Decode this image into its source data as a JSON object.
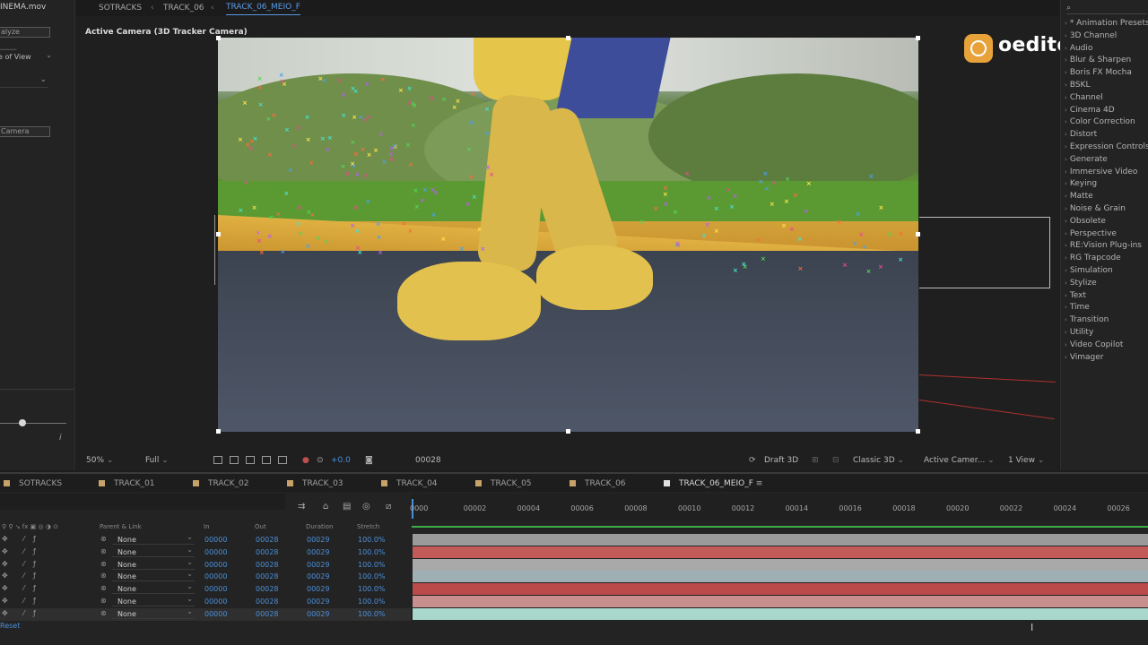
{
  "left_panel": {
    "title": "INEMA.mov",
    "analyze_button": "alyze",
    "shot_type_label": "e of View",
    "camera_button": "Camera",
    "info_icon": "i"
  },
  "breadcrumbs": [
    "SOTRACKS",
    "TRACK_06",
    "TRACK_06_MEIO_F"
  ],
  "viewer": {
    "camera_label": "Active Camera (3D Tracker Camera)"
  },
  "viewer_toolbar": {
    "zoom": "50%",
    "resolution": "Full",
    "exposure": "+0.0",
    "frame": "00028",
    "draft": "Draft 3D",
    "renderer": "Classic 3D",
    "view": "Active Camer...",
    "view_count": "1 View"
  },
  "logo": {
    "text": "oeditor"
  },
  "effects_panel": {
    "search_placeholder": "",
    "items": [
      "* Animation Presets",
      "3D Channel",
      "Audio",
      "Blur & Sharpen",
      "Boris FX Mocha",
      "BSKL",
      "Channel",
      "Cinema 4D",
      "Color Correction",
      "Distort",
      "Expression Controls",
      "Generate",
      "Immersive Video",
      "Keying",
      "Matte",
      "Noise & Grain",
      "Obsolete",
      "Perspective",
      "RE:Vision Plug-ins",
      "RG Trapcode",
      "Simulation",
      "Stylize",
      "Text",
      "Time",
      "Transition",
      "Utility",
      "Video Copilot",
      "Vimager"
    ]
  },
  "timeline": {
    "tabs": [
      "SOTRACKS",
      "TRACK_01",
      "TRACK_02",
      "TRACK_03",
      "TRACK_04",
      "TRACK_05",
      "TRACK_06",
      "TRACK_06_MEIO_F"
    ],
    "columns": {
      "parent": "Parent & Link",
      "in": "In",
      "out": "Out",
      "duration": "Duration",
      "stretch": "Stretch"
    },
    "ruler": [
      "0000",
      "00002",
      "00004",
      "00006",
      "00008",
      "00010",
      "00012",
      "00014",
      "00016",
      "00018",
      "00020",
      "00022",
      "00024",
      "00026"
    ],
    "layers": [
      {
        "parent": "None",
        "in": "00000",
        "out": "00028",
        "duration": "00029",
        "stretch": "100.0%"
      },
      {
        "parent": "None",
        "in": "00000",
        "out": "00028",
        "duration": "00029",
        "stretch": "100.0%"
      },
      {
        "parent": "None",
        "in": "00000",
        "out": "00028",
        "duration": "00029",
        "stretch": "100.0%"
      },
      {
        "parent": "None",
        "in": "00000",
        "out": "00028",
        "duration": "00029",
        "stretch": "100.0%"
      },
      {
        "parent": "None",
        "in": "00000",
        "out": "00028",
        "duration": "00029",
        "stretch": "100.0%"
      },
      {
        "parent": "None",
        "in": "00000",
        "out": "00028",
        "duration": "00029",
        "stretch": "100.0%"
      },
      {
        "parent": "None",
        "in": "00000",
        "out": "00028",
        "duration": "00029",
        "stretch": "100.0%"
      }
    ],
    "bar_colors": [
      "#9a9a9a",
      "#c25a5a",
      "#a9a9a9",
      "#9fb0b5",
      "#bb4a4a",
      "#c98e8e",
      "#a8d8cc"
    ],
    "reset_label": "Reset"
  }
}
